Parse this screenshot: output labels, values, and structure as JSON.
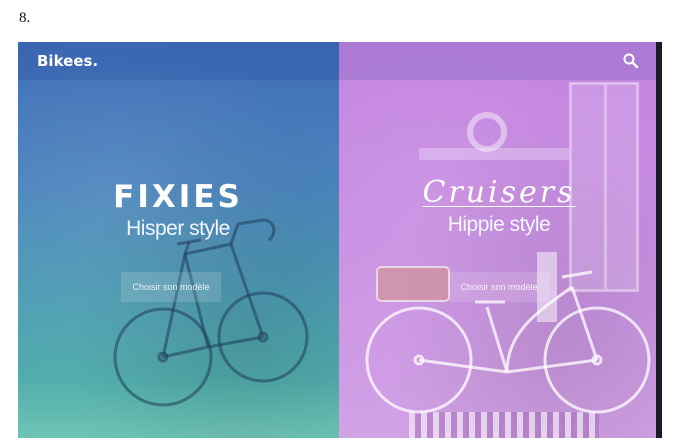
{
  "document": {
    "item_number": "8."
  },
  "header": {
    "brand": "Bikees.",
    "search_icon": "search-icon"
  },
  "panels": [
    {
      "id": "fixies",
      "title": "FIXIES",
      "subtitle": "Hisper style",
      "cta_label": "Choisir son modèle",
      "overlay_colors": [
        "#3f6db8",
        "#55b8a7"
      ]
    },
    {
      "id": "cruisers",
      "title": "Cruisers",
      "subtitle": "Hippie style",
      "cta_label": "Choisir son modèle",
      "overlay_colors": [
        "#c384e0",
        "#d2a2e6"
      ]
    }
  ]
}
